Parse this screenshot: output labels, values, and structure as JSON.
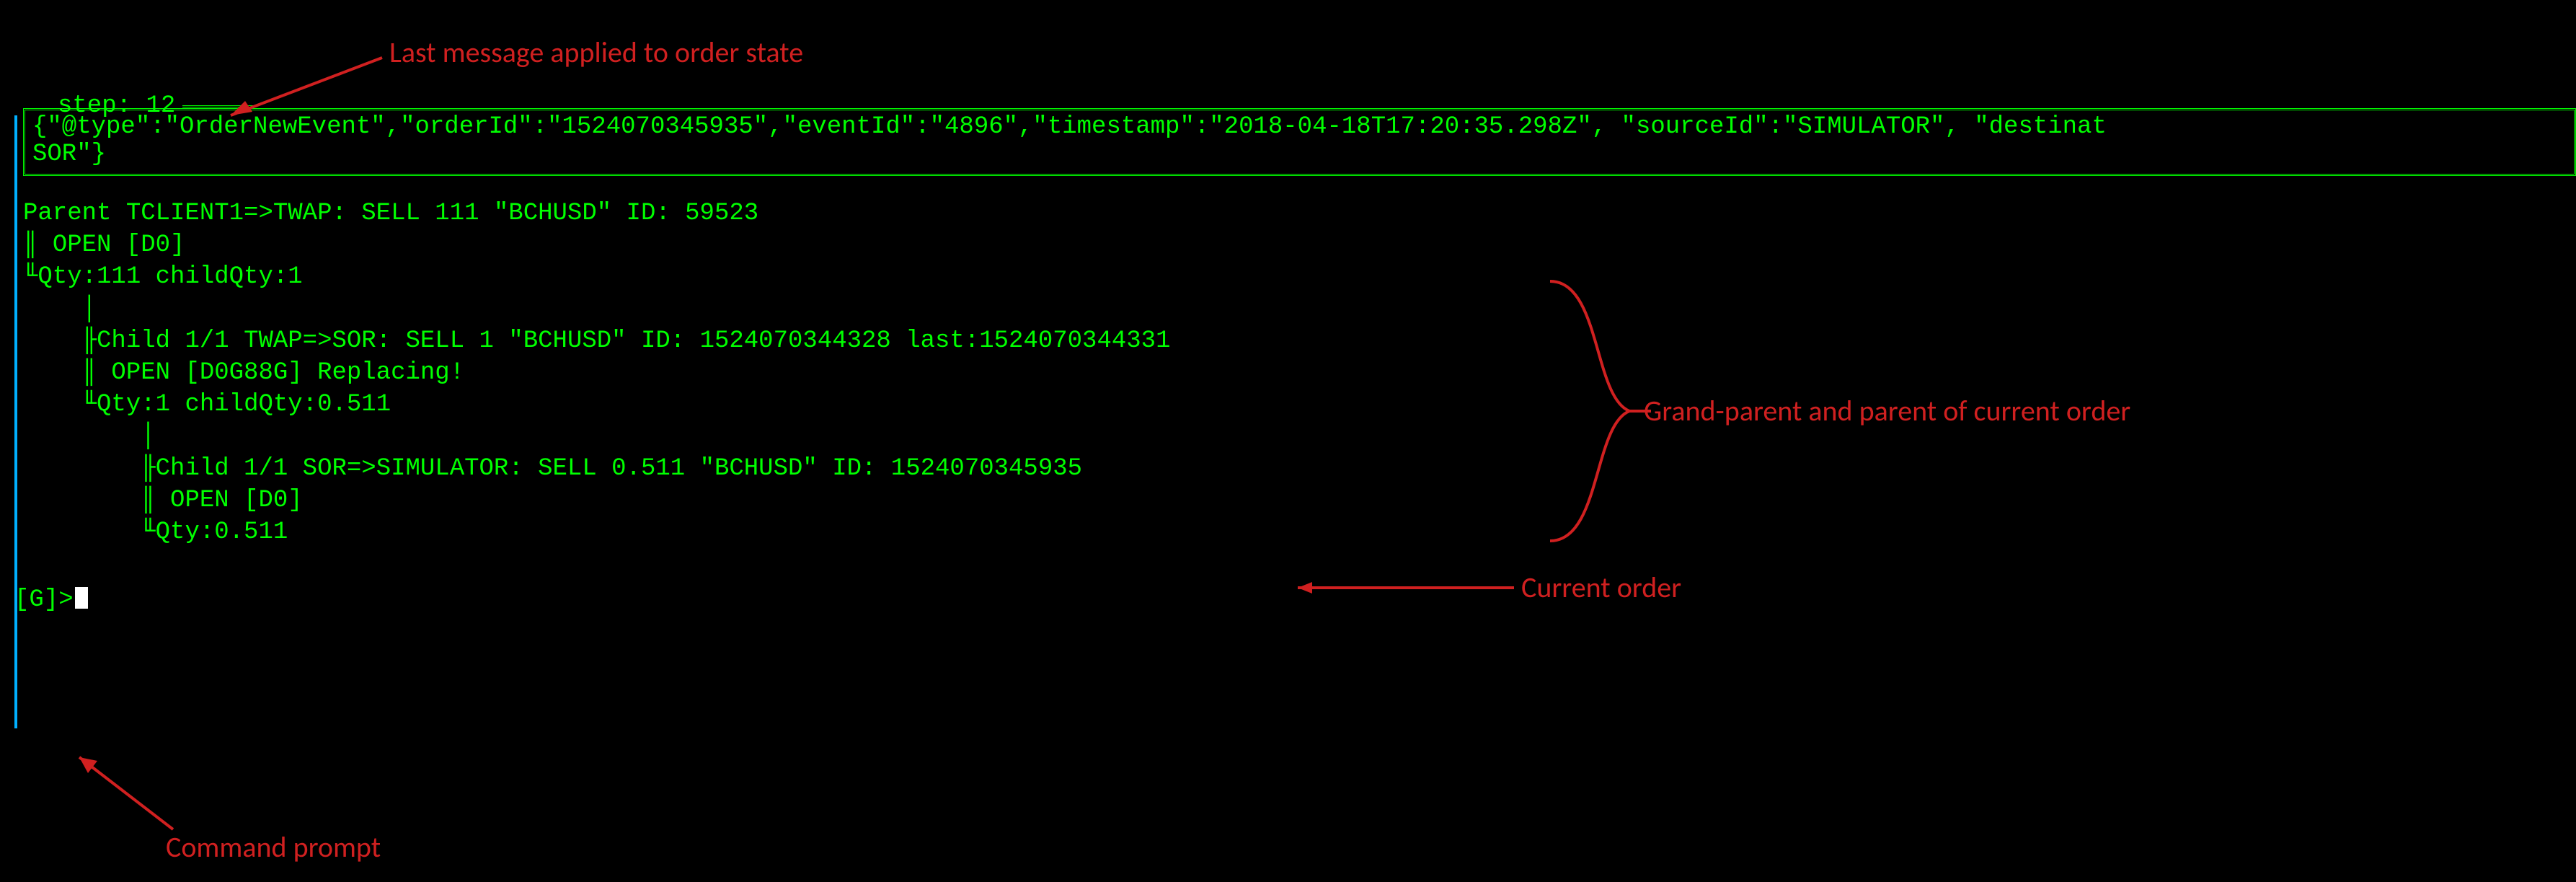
{
  "annotations": {
    "last_message": "Last message applied to order state",
    "grandparent": "Grand-parent and parent of current order",
    "current_order": "Current order",
    "command_prompt": "Command prompt"
  },
  "step": {
    "label": "step:",
    "number": "12"
  },
  "event_json": "{\"@type\":\"OrderNewEvent\",\"orderId\":\"1524070345935\",\"eventId\":\"4896\",\"timestamp\":\"2018-04-18T17:20:35.298Z\", \"sourceId\":\"SIMULATOR\", \"destinat\nSOR\"}",
  "tree": {
    "parent": {
      "header": "Parent TCLIENT1=>TWAP: SELL 111 \"BCHUSD\" ID: 59523",
      "status": "OPEN [D0]",
      "qty": "Qty:111 childQty:1"
    },
    "child": {
      "header": "Child 1/1 TWAP=>SOR: SELL 1 \"BCHUSD\" ID: 1524070344328 last:1524070344331",
      "status": "OPEN [D0G88G] Replacing!",
      "qty": "Qty:1 childQty:0.511"
    },
    "grandchild": {
      "header": "Child 1/1 SOR=>SIMULATOR: SELL 0.511 \"BCHUSD\" ID: 1524070345935",
      "status": "OPEN [D0]",
      "qty": "Qty:0.511"
    }
  },
  "prompt": "[G]>"
}
